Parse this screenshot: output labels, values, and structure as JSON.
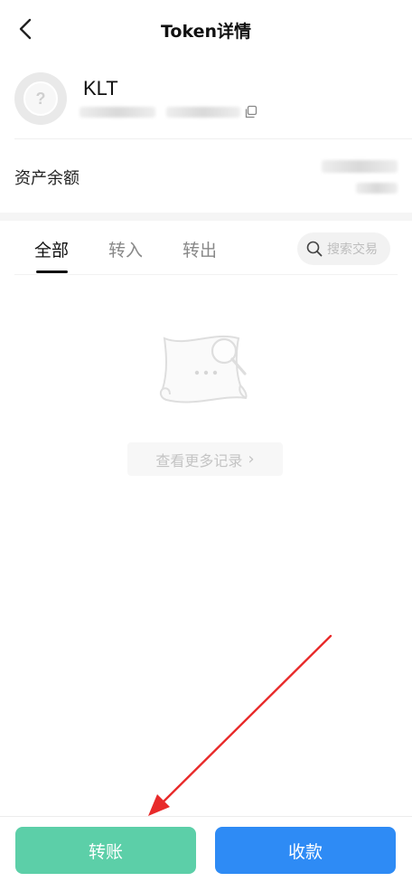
{
  "header": {
    "title": "Token详情",
    "back_icon": "chevron-left-icon"
  },
  "token": {
    "symbol": "KLT",
    "avatar_icon": "question-mark-icon",
    "copy_icon": "copy-icon"
  },
  "balance": {
    "label": "资产余额"
  },
  "tabs": [
    {
      "label": "全部",
      "active": true
    },
    {
      "label": "转入",
      "active": false
    },
    {
      "label": "转出",
      "active": false
    }
  ],
  "search": {
    "placeholder": "搜索交易",
    "icon": "search-icon"
  },
  "empty_state": {
    "illustration": "empty-document-search-icon",
    "more_records_label": "查看更多记录",
    "more_records_icon": "chevron-right-icon"
  },
  "actions": {
    "transfer_label": "转账",
    "receive_label": "收款"
  },
  "colors": {
    "transfer_button": "#5ccfa8",
    "receive_button": "#2e8bf5",
    "annotation_arrow": "#e82a2a"
  }
}
